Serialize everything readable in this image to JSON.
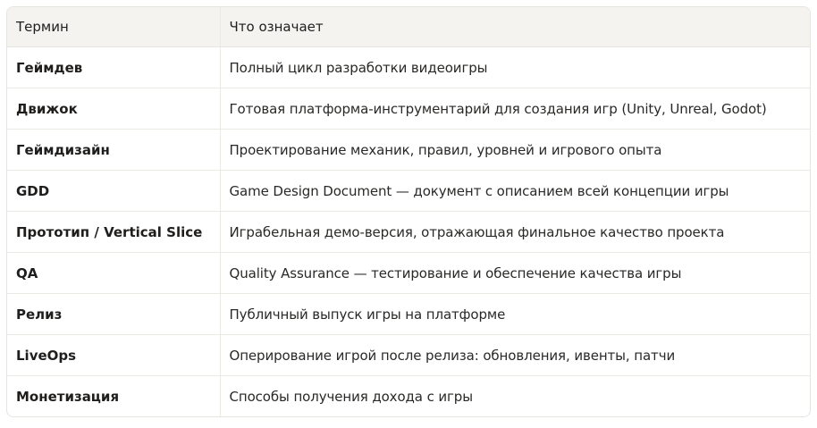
{
  "table": {
    "headers": [
      "Термин",
      "Что означает"
    ],
    "rows": [
      {
        "term": "Геймдев",
        "meaning": "Полный цикл разработки видеоигры"
      },
      {
        "term": "Движок",
        "meaning": "Готовая платформа-инструментарий для создания игр (Unity, Unreal, Godot)"
      },
      {
        "term": "Геймдизайн",
        "meaning": "Проектирование механик, правил, уровней и игрового опыта"
      },
      {
        "term": "GDD",
        "meaning": "Game Design Document — документ с описанием всей концепции игры"
      },
      {
        "term": "Прототип / Vertical Slice",
        "meaning": "Играбельная демо-версия, отражающая финальное качество проекта"
      },
      {
        "term": "QA",
        "meaning": "Quality Assurance — тестирование и обеспечение качества игры"
      },
      {
        "term": "Релиз",
        "meaning": "Публичный выпуск игры на платформе"
      },
      {
        "term": "LiveOps",
        "meaning": "Оперирование игрой после релиза: обновления, ивенты, патчи"
      },
      {
        "term": "Монетизация",
        "meaning": "Способы получения дохода с игры"
      }
    ]
  }
}
